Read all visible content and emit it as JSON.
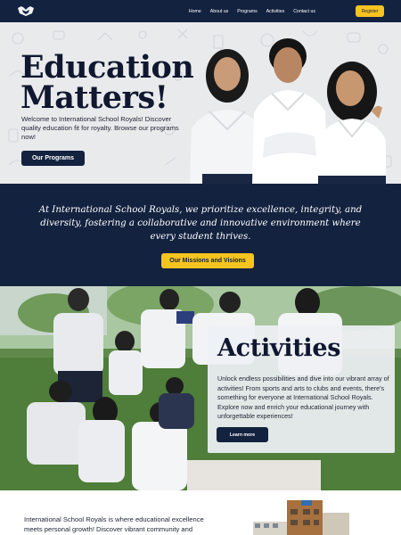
{
  "nav": {
    "logo_icon": "school-crest-logo",
    "links": [
      "Home",
      "About us",
      "Programs",
      "Activities",
      "Contact us"
    ],
    "register_label": "Register"
  },
  "hero": {
    "title_line1": "Education",
    "title_line2": "Matters!",
    "description": "Welcome to International School Royals! Discover quality education fit for royalty. Browse our programs now!",
    "button_label": "Our Programs"
  },
  "mission": {
    "text": "At International School Royals, we prioritize excellence, integrity, and diversity, fostering a collaborative and innovative environment where every student thrives.",
    "button_label": "Our Missions and Visions"
  },
  "activities": {
    "title": "Activities",
    "description": "Unlock endless possibilities and dive into our vibrant array of activities! From sports and arts to clubs and events, there's something for everyone at International School Royals. Explore now and enrich your educational journey with unforgettable experiences!",
    "button_label": "Learn more"
  },
  "about": {
    "text": "International School Royals is where educational excellence meets personal growth! Discover vibrant community and"
  },
  "colors": {
    "navy": "#13223f",
    "accent_yellow": "#f6c31f",
    "hero_bg": "#e9eaec",
    "white": "#ffffff"
  }
}
